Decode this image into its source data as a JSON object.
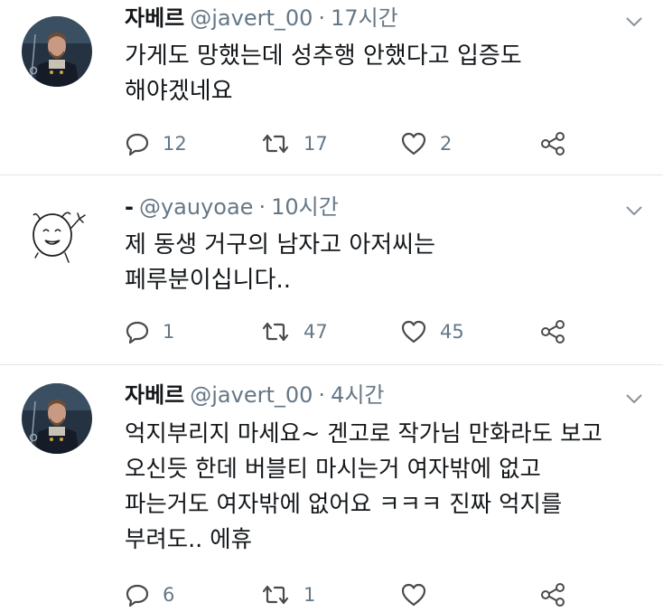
{
  "tweets": [
    {
      "name": "자베르",
      "handle": "@javert_00",
      "dot": "·",
      "time": "17시간",
      "text": "가게도 망했는데 성추행 안했다고 입증도 해야겠네요",
      "replies": "12",
      "retweets": "17",
      "likes": "2"
    },
    {
      "name": "-",
      "handle": "@yauyoae",
      "dot": "·",
      "time": "10시간",
      "text": "제 동생 거구의 남자고 아저씨는 페루분이십니다..",
      "replies": "1",
      "retweets": "47",
      "likes": "45"
    },
    {
      "name": "자베르",
      "handle": "@javert_00",
      "dot": "·",
      "time": "4시간",
      "text": "억지부리지 마세요~ 겐고로 작가님 만화라도 보고 오신듯 한데 버블티 마시는거 여자밖에 없고 파는거도 여자밖에 없어요 ㅋㅋㅋ 진짜 억지를 부려도.. 에휴",
      "replies": "6",
      "retweets": "1",
      "likes": ""
    }
  ],
  "icons": {
    "reply": "reply-icon",
    "retweet": "retweet-icon",
    "like": "heart-icon",
    "share": "share-icon",
    "caret": "chevron-down-icon"
  },
  "colors": {
    "text": "#14171a",
    "secondary": "#657786",
    "icon": "#4a4a4a",
    "divider": "#e1e8ed"
  }
}
